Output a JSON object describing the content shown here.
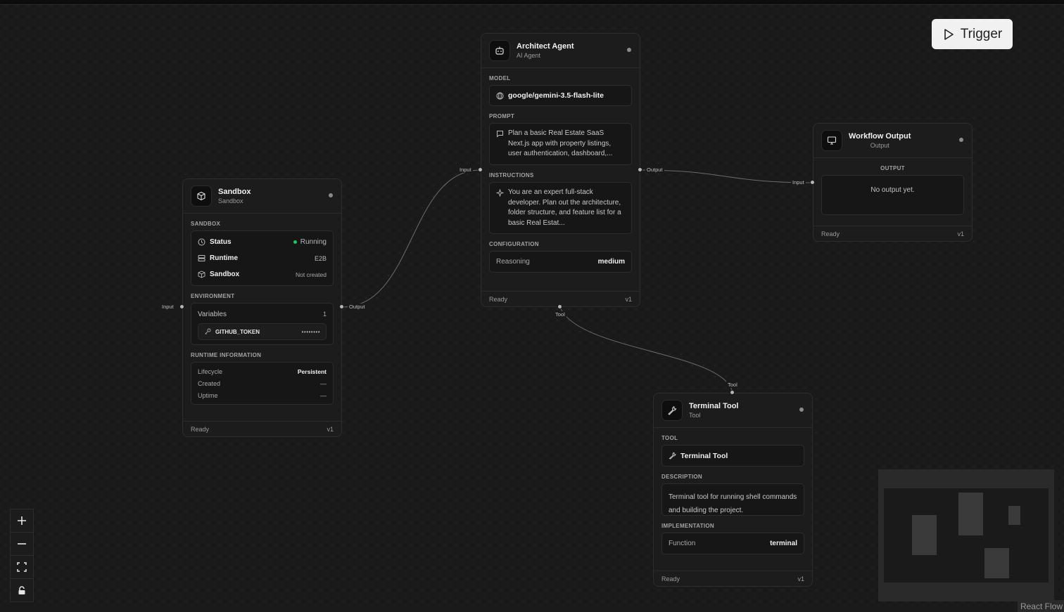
{
  "trigger": {
    "label": "Trigger"
  },
  "architect": {
    "title": "Architect Agent",
    "subtitle": "AI Agent",
    "model_label": "MODEL",
    "model_value": "google/gemini-3.5-flash-lite",
    "prompt_label": "PROMPT",
    "prompt_value": "Plan a basic Real Estate SaaS Next.js app with property listings, user authentication, dashboard,...",
    "instructions_label": "INSTRUCTIONS",
    "instructions_value": "You are an expert full-stack developer. Plan out the architecture, folder structure, and feature list for a basic Real Estat...",
    "configuration_label": "CONFIGURATION",
    "config_key": "Reasoning",
    "config_value": "medium",
    "footer_status": "Ready",
    "footer_version": "v1",
    "input_label": "Input",
    "output_label": "Output",
    "tool_label": "Tool"
  },
  "sandbox": {
    "title": "Sandbox",
    "subtitle": "Sandbox",
    "section_label": "SANDBOX",
    "rows": [
      {
        "key": "Status",
        "value": "Running"
      },
      {
        "key": "Runtime",
        "value": "E2B"
      },
      {
        "key": "Sandbox",
        "value": "Not created"
      }
    ],
    "env_label": "ENVIRONMENT",
    "variables_label": "Variables",
    "variables_count": "1",
    "token_name": "GITHUB_TOKEN",
    "token_mask": "••••••••",
    "runtime_info_label": "RUNTIME INFORMATION",
    "runtime_rows": [
      {
        "key": "Lifecycle",
        "value": "Persistent"
      },
      {
        "key": "Created",
        "value": "—"
      },
      {
        "key": "Uptime",
        "value": "—"
      }
    ],
    "footer_status": "Ready",
    "footer_version": "v1",
    "input_label": "Input",
    "output_label": "Output",
    "status_color": "#22c55e"
  },
  "workflow_output": {
    "title": "Workflow Output",
    "subtitle": "Output",
    "section_label": "OUTPUT",
    "empty_text": "No output yet.",
    "footer_status": "Ready",
    "footer_version": "v1",
    "input_label": "Input"
  },
  "terminal": {
    "title": "Terminal Tool",
    "subtitle": "Tool",
    "tool_label": "TOOL",
    "tool_value": "Terminal Tool",
    "description_label": "DESCRIPTION",
    "description_value": "Terminal tool for running shell commands and building the project.",
    "implementation_label": "IMPLEMENTATION",
    "impl_key": "Function",
    "impl_value": "terminal",
    "footer_status": "Ready",
    "footer_version": "v1",
    "handle_label": "Tool"
  },
  "attribution": "React Flow"
}
